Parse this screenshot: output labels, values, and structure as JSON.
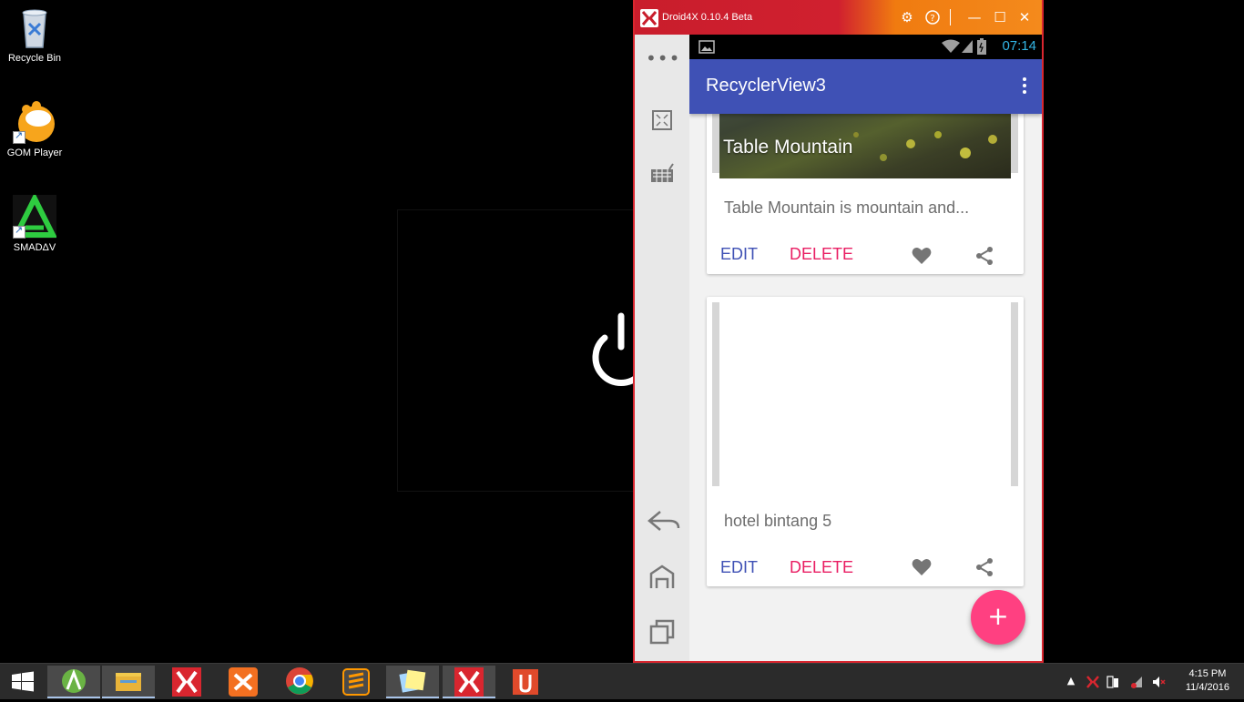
{
  "desktop": {
    "icons": [
      {
        "label": "Recycle Bin"
      },
      {
        "label": "GOM Player"
      },
      {
        "label": "SMADΔV"
      }
    ]
  },
  "emulator": {
    "title": "Droid4X 0.10.4 Beta",
    "sidebar": [
      "more-icon",
      "fullscreen-icon",
      "keyboard-icon",
      "back-icon",
      "home-icon",
      "recent-apps-icon"
    ]
  },
  "android": {
    "status_time": "07:14",
    "app_title": "RecyclerView3",
    "cards": [
      {
        "image_title": "Table Mountain",
        "description": "Table Mountain is mountain and...",
        "edit_label": "EDIT",
        "delete_label": "DELETE"
      },
      {
        "image_title": "",
        "description": "hotel bintang 5",
        "edit_label": "EDIT",
        "delete_label": "DELETE"
      }
    ],
    "fab_label": "+"
  },
  "taskbar": {
    "clock_time": "4:15 PM",
    "clock_date": "11/4/2016"
  },
  "colors": {
    "app_bar": "#3f51b5",
    "accent": "#e91e63",
    "fab": "#ff4081",
    "emulator_border": "#d9262f"
  }
}
